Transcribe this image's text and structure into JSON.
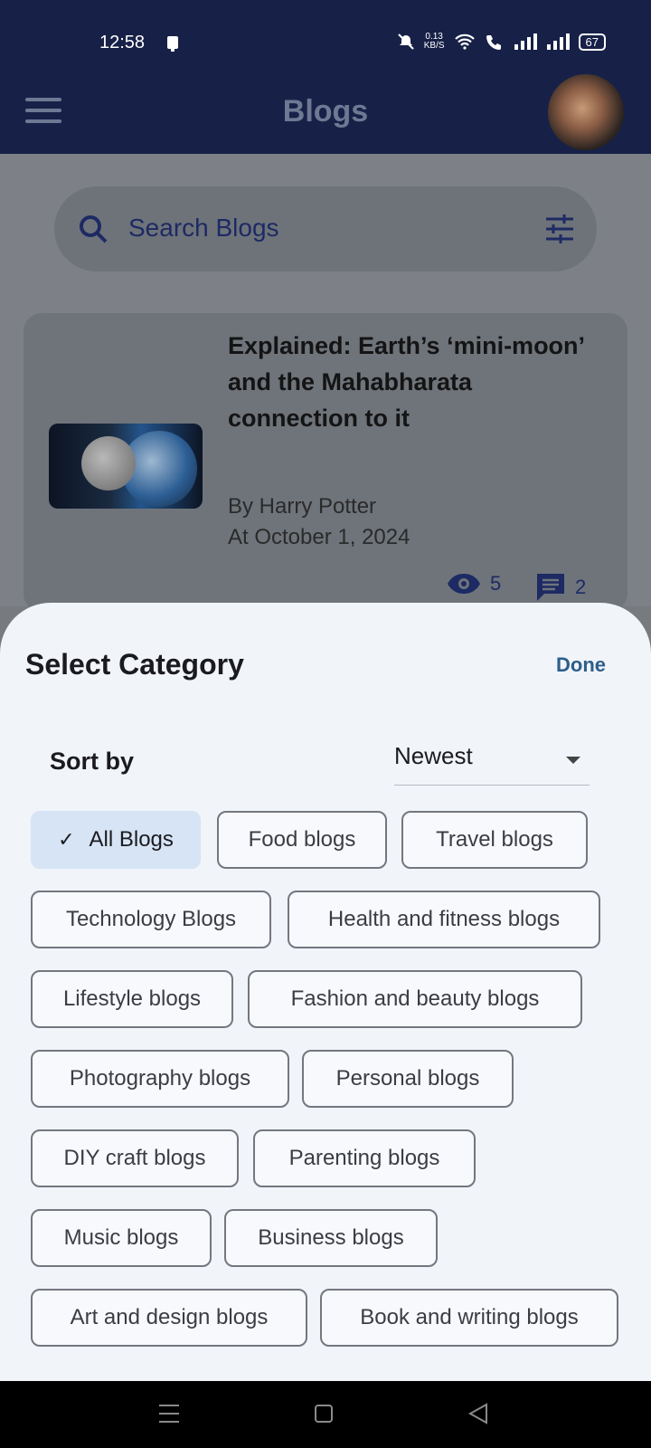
{
  "status": {
    "time": "12:58",
    "speed_top": "0.13",
    "speed_unit": "KB/S",
    "battery": "67"
  },
  "appbar": {
    "title": "Blogs"
  },
  "search": {
    "placeholder": "Search Blogs"
  },
  "blog_card": {
    "title": "Explained: Earth’s ‘mini-moon’ and the Mahabharata connection to it",
    "author": "By Harry Potter",
    "date": "At October 1, 2024",
    "views": "5",
    "comments": "2"
  },
  "sheet": {
    "title": "Select Category",
    "done_label": "Done",
    "sort_label": "Sort by",
    "sort_value": "Newest"
  },
  "categories": [
    {
      "label": "All Blogs",
      "selected": true
    },
    {
      "label": "Food blogs",
      "selected": false
    },
    {
      "label": "Travel blogs",
      "selected": false
    },
    {
      "label": "Technology Blogs",
      "selected": false
    },
    {
      "label": "Health and fitness blogs",
      "selected": false
    },
    {
      "label": "Lifestyle blogs",
      "selected": false
    },
    {
      "label": "Fashion and beauty blogs",
      "selected": false
    },
    {
      "label": "Photography blogs",
      "selected": false
    },
    {
      "label": "Personal blogs",
      "selected": false
    },
    {
      "label": "DIY craft blogs",
      "selected": false
    },
    {
      "label": "Parenting blogs",
      "selected": false
    },
    {
      "label": "Music blogs",
      "selected": false
    },
    {
      "label": "Business blogs",
      "selected": false
    },
    {
      "label": "Art and design blogs",
      "selected": false
    },
    {
      "label": "Book and writing blogs",
      "selected": false
    }
  ],
  "colors": {
    "app_bar": "#172148",
    "accent": "#2c5e8a",
    "chip_selected": "#d6e4f5"
  }
}
